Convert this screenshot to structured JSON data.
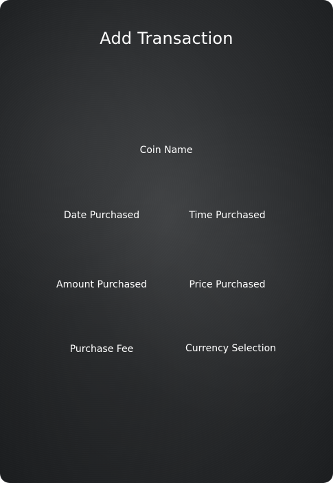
{
  "form": {
    "title": "Add Transaction",
    "fields": {
      "coin_name": "Coin Name",
      "date_purchased": "Date Purchased",
      "time_purchased": "Time Purchased",
      "amount_purchased": "Amount Purchased",
      "price_purchased": "Price Purchased",
      "purchase_fee": "Purchase Fee",
      "currency_selection": "Currency Selection"
    }
  },
  "colors": {
    "background": "#2c2e30",
    "text": "#ffffff"
  }
}
